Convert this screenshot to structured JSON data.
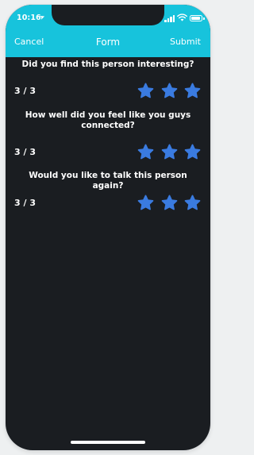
{
  "status_bar": {
    "time": "10:16",
    "icons": [
      "location-arrow-icon",
      "signal-icon",
      "wifi-icon",
      "battery-icon"
    ]
  },
  "nav": {
    "cancel_label": "Cancel",
    "title": "Form",
    "submit_label": "Submit"
  },
  "colors": {
    "header": "#17c3dc",
    "background": "#1a1d21",
    "star": "#3a7be0"
  },
  "questions": [
    {
      "text": "Did you find this person interesting?",
      "score": "3 / 3",
      "rating": 3,
      "max": 3
    },
    {
      "text": "How well did you feel like you guys connected?",
      "score": "3 / 3",
      "rating": 3,
      "max": 3
    },
    {
      "text": "Would you like to talk this person again?",
      "score": "3 / 3",
      "rating": 3,
      "max": 3
    }
  ]
}
